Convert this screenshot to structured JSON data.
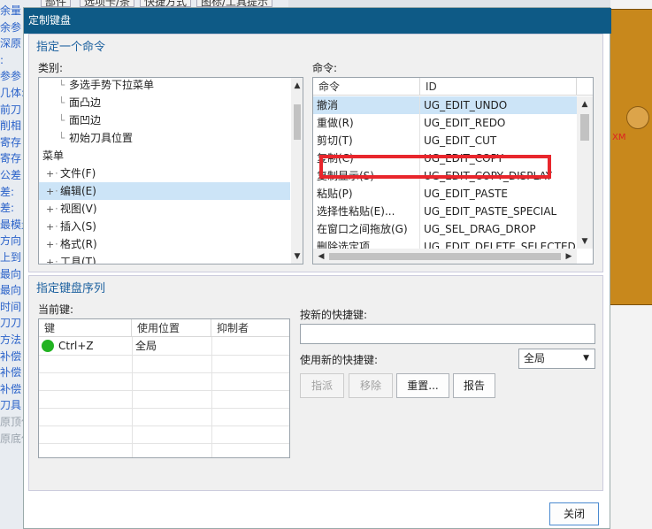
{
  "background": {
    "left_snippets": [
      "余量",
      "余参",
      "深原",
      ":",
      "参参",
      "几体:",
      "前刀",
      "削相",
      "寄存",
      "寄存",
      "公差",
      "差:",
      "差:",
      "最模量",
      "方向",
      "上到",
      "最向",
      "最向",
      "时间",
      "刀刀",
      "方法",
      "补偿",
      "补偿",
      "补偿",
      "刀具",
      "原顶偏",
      "原底偏"
    ],
    "top_tabs": [
      "部件",
      "选项卡/条",
      "快捷方式",
      "图标/工具提示"
    ],
    "cad_label": "XM"
  },
  "dialog": {
    "title": "定制键盘",
    "command_section": {
      "heading": "指定一个命令",
      "category_label": "类别:",
      "command_label": "命令:",
      "categories": [
        {
          "label": "多选手势下拉菜单",
          "indent": 2,
          "expand": ""
        },
        {
          "label": "面凸边",
          "indent": 2,
          "expand": ""
        },
        {
          "label": "面凹边",
          "indent": 2,
          "expand": ""
        },
        {
          "label": "初始刀具位置",
          "indent": 2,
          "expand": ""
        },
        {
          "label": "菜单",
          "indent": 0,
          "expand": ""
        },
        {
          "label": "文件(F)",
          "indent": 1,
          "expand": "+"
        },
        {
          "label": "编辑(E)",
          "indent": 1,
          "expand": "+",
          "selected": true
        },
        {
          "label": "视图(V)",
          "indent": 1,
          "expand": "+"
        },
        {
          "label": "插入(S)",
          "indent": 1,
          "expand": "+"
        },
        {
          "label": "格式(R)",
          "indent": 1,
          "expand": "+"
        },
        {
          "label": "工具(T)",
          "indent": 1,
          "expand": "+"
        }
      ],
      "commands_header": {
        "name": "命令",
        "id": "ID"
      },
      "commands": [
        {
          "name": "撤消",
          "id": "UG_EDIT_UNDO",
          "selected": true
        },
        {
          "name": "重做(R)",
          "id": "UG_EDIT_REDO"
        },
        {
          "name": "剪切(T)",
          "id": "UG_EDIT_CUT"
        },
        {
          "name": "复制(C)",
          "id": "UG_EDIT_COPY",
          "highlighted": true
        },
        {
          "name": "复制显示(S)",
          "id": "UG_EDIT_COPY_DISPLAY"
        },
        {
          "name": "粘贴(P)",
          "id": "UG_EDIT_PASTE"
        },
        {
          "name": "选择性粘贴(E)...",
          "id": "UG_EDIT_PASTE_SPECIAL"
        },
        {
          "name": "在窗口之间拖放(G)",
          "id": "UG_SEL_DRAG_DROP"
        },
        {
          "name": "删除选定项",
          "id": "UG_EDIT_DELETE_SELECTED"
        }
      ]
    },
    "key_section": {
      "heading": "指定键盘序列",
      "current_keys_label": "当前键:",
      "columns": [
        "键",
        "使用位置",
        "抑制者"
      ],
      "keys": [
        {
          "key": "Ctrl+Z",
          "where": "全局",
          "suppressor": "",
          "status_color": "#22b322"
        }
      ],
      "new_key_label": "按新的快捷键:",
      "new_key_value": "",
      "use_label": "使用新的快捷键:",
      "use_select_value": "全局",
      "buttons": {
        "assign": "指派",
        "remove": "移除",
        "reset": "重置...",
        "report": "报告"
      }
    },
    "close_button": "关闭",
    "highlight_color": "#e8262c",
    "accent_color": "#0e5a86"
  }
}
